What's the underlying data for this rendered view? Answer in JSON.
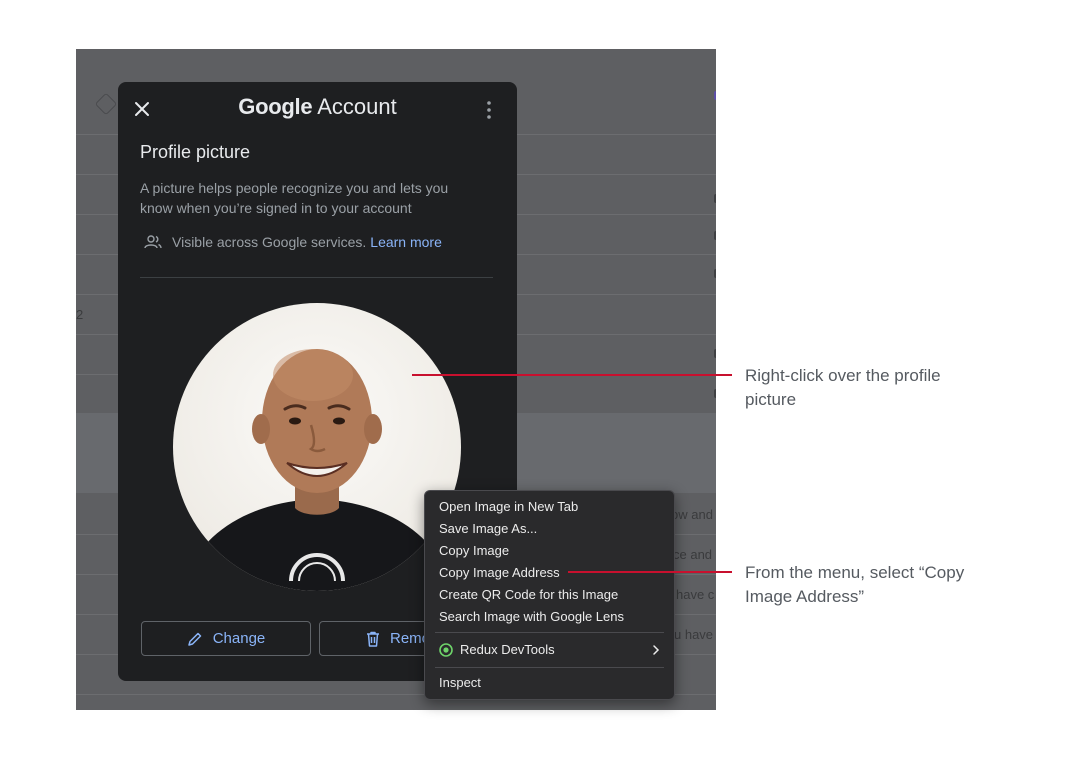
{
  "background_fragments": [
    "2",
    "ow and",
    "ce and",
    "have c",
    "u have"
  ],
  "dialog": {
    "brand_google": "Google",
    "brand_account": "Account",
    "title": "Profile picture",
    "description": "A picture helps people recognize you and lets you know when you’re signed in to your account",
    "visibility_text": "Visible across Google services.",
    "learn_more": "Learn more",
    "change_label": "Change",
    "remove_label": "Remo",
    "icons": [
      "close-icon",
      "more-vert-icon",
      "people-icon",
      "pencil-icon",
      "trash-icon"
    ]
  },
  "context_menu": {
    "items": [
      "Open Image in New Tab",
      "Save Image As...",
      "Copy Image",
      "Copy Image Address",
      "Create QR Code for this Image",
      "Search Image with Google Lens"
    ],
    "extension": "Redux DevTools",
    "inspect": "Inspect"
  },
  "callouts": {
    "first": "Right-click over the profile picture",
    "second": "From the menu, select “Copy Image Address”"
  },
  "colors": {
    "accent_link": "#8ab4f8",
    "callout_line": "#c8102e",
    "dialog_bg": "#1e1f21",
    "menu_bg": "#2a2a2c"
  }
}
